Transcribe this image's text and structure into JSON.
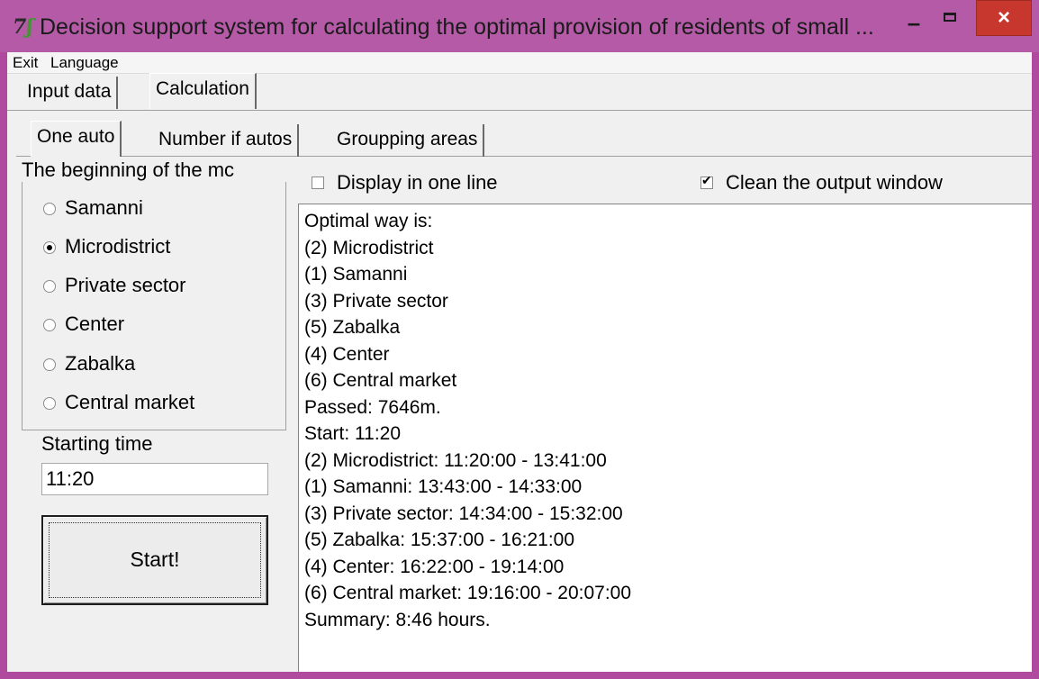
{
  "window": {
    "title": "Decision support system for calculating the optimal provision of residents of small ...",
    "minimize": "–",
    "close": "×"
  },
  "menu": {
    "exit": "Exit",
    "language": "Language"
  },
  "tabs_main": [
    {
      "label": "Input data",
      "selected": false
    },
    {
      "label": "Calculation",
      "selected": true
    }
  ],
  "tabs_sub": [
    {
      "label": "One auto",
      "selected": true
    },
    {
      "label": "Number if autos",
      "selected": false
    },
    {
      "label": "Groupping areas",
      "selected": false
    }
  ],
  "route_group": {
    "title": "The beginning of the mc",
    "options": [
      {
        "label": "Samanni",
        "checked": false
      },
      {
        "label": "Microdistrict",
        "checked": true
      },
      {
        "label": "Private sector",
        "checked": false
      },
      {
        "label": "Center",
        "checked": false
      },
      {
        "label": "Zabalka",
        "checked": false
      },
      {
        "label": "Central market",
        "checked": false
      }
    ]
  },
  "start": {
    "label": "Starting time",
    "value": "11:20",
    "button": "Start!"
  },
  "options": {
    "one_line": {
      "label": "Display in one line",
      "checked": false
    },
    "clean_output": {
      "label": "Clean the output window",
      "checked": true
    }
  },
  "output": {
    "lines": [
      "Optimal way is:",
      "(2) Microdistrict",
      "(1) Samanni",
      "(3) Private sector",
      "(5) Zabalka",
      "(4) Center",
      "(6) Central market",
      "Passed: 7646m.",
      "Start: 11:20",
      "(2) Microdistrict: 11:20:00 - 13:41:00",
      "(1) Samanni: 13:43:00 - 14:33:00",
      "(3) Private sector: 14:34:00 - 15:32:00",
      "(5) Zabalka: 15:37:00 - 16:21:00",
      "(4) Center: 16:22:00 - 19:14:00",
      "(6) Central market: 19:16:00 - 20:07:00",
      "Summary: 8:46 hours."
    ]
  },
  "colors": {
    "title_bar": "#b45aa6",
    "close_button": "#c7372e",
    "client_bg": "#f0f0f0"
  }
}
